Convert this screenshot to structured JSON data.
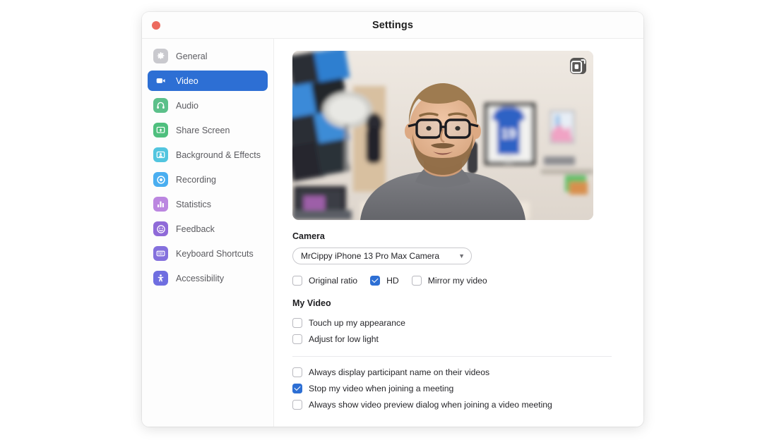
{
  "window": {
    "title": "Settings",
    "close_button": "close"
  },
  "accent_color": "#2d6fd4",
  "sidebar": {
    "items": [
      {
        "label": "General",
        "icon": "gear-icon",
        "color": "#c9c9ce",
        "active": false
      },
      {
        "label": "Video",
        "icon": "video-camera-icon",
        "color": "#2d6fd4",
        "active": true
      },
      {
        "label": "Audio",
        "icon": "headphones-icon",
        "color": "#5cc08a",
        "active": false
      },
      {
        "label": "Share Screen",
        "icon": "share-screen-icon",
        "color": "#4fbf7e",
        "active": false
      },
      {
        "label": "Background & Effects",
        "icon": "person-frame-icon",
        "color": "#52c5df",
        "active": false
      },
      {
        "label": "Recording",
        "icon": "record-circle-icon",
        "color": "#4aaef0",
        "active": false
      },
      {
        "label": "Statistics",
        "icon": "bar-chart-icon",
        "color": "#bb86e0",
        "active": false
      },
      {
        "label": "Feedback",
        "icon": "smiley-face-icon",
        "color": "#8f6ad8",
        "active": false
      },
      {
        "label": "Keyboard Shortcuts",
        "icon": "keyboard-icon",
        "color": "#8470dd",
        "active": false
      },
      {
        "label": "Accessibility",
        "icon": "accessibility-icon",
        "color": "#6f6ee0",
        "active": false
      }
    ]
  },
  "main": {
    "video_preview": {
      "pip_button_icon": "picture-in-picture-icon"
    },
    "camera_section": {
      "heading": "Camera",
      "selected_device": "MrCippy iPhone 13 Pro Max Camera",
      "options": [
        "MrCippy iPhone 13 Pro Max Camera"
      ],
      "checkboxes": [
        {
          "label": "Original ratio",
          "checked": false
        },
        {
          "label": "HD",
          "checked": true
        },
        {
          "label": "Mirror my video",
          "checked": false
        }
      ]
    },
    "my_video_section": {
      "heading": "My Video",
      "checkboxes": [
        {
          "label": "Touch up my appearance",
          "checked": false
        },
        {
          "label": "Adjust for low light",
          "checked": false
        }
      ]
    },
    "meeting_section": {
      "checkboxes": [
        {
          "label": "Always display participant name on their videos",
          "checked": false
        },
        {
          "label": "Stop my video when joining a meeting",
          "checked": true
        },
        {
          "label": "Always show video preview dialog when joining a video meeting",
          "checked": false
        }
      ]
    }
  }
}
